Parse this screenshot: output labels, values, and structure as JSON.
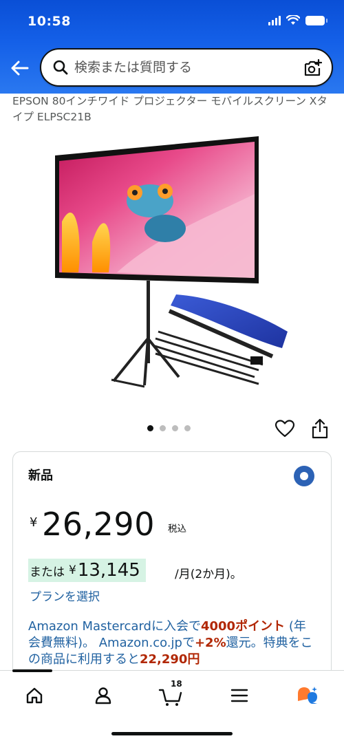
{
  "status_bar": {
    "time": "10:58"
  },
  "header": {
    "back_icon": "arrow-left-icon",
    "search_placeholder": "検索または質問する",
    "camera_icon": "camera-search-icon"
  },
  "product": {
    "title": "EPSON 80インチワイド プロジェクター モバイルスクリーン Xタイプ ELPSC21B",
    "image_carousel": {
      "count": 4,
      "active_index": 0
    }
  },
  "offer": {
    "condition": "新品",
    "currency_symbol": "¥",
    "price": "26,290",
    "tax_label": "税込",
    "installment_prefix": "または",
    "installment_currency": "¥",
    "installment_amount": "13,145",
    "installment_suffix": "/月(2か月)。",
    "plan_link": "プランを選択",
    "promo_1": "Amazon Mastercardに入会で",
    "promo_points": "4000ポイント",
    "promo_2": " (年会費無料)。 Amazon.co.jpで",
    "promo_rate": "+2%",
    "promo_3": "還元。特典をこの商品に利用すると",
    "promo_price": "22,290円"
  },
  "bottom_nav": {
    "items": [
      "home-icon",
      "account-icon",
      "cart-icon",
      "menu-icon",
      "assistant-icon"
    ],
    "cart_count": "18"
  },
  "colors": {
    "header_blue": "#1460e8",
    "link": "#2162a1",
    "deal_red": "#b12704",
    "installment_bg": "#d6f3e4"
  }
}
